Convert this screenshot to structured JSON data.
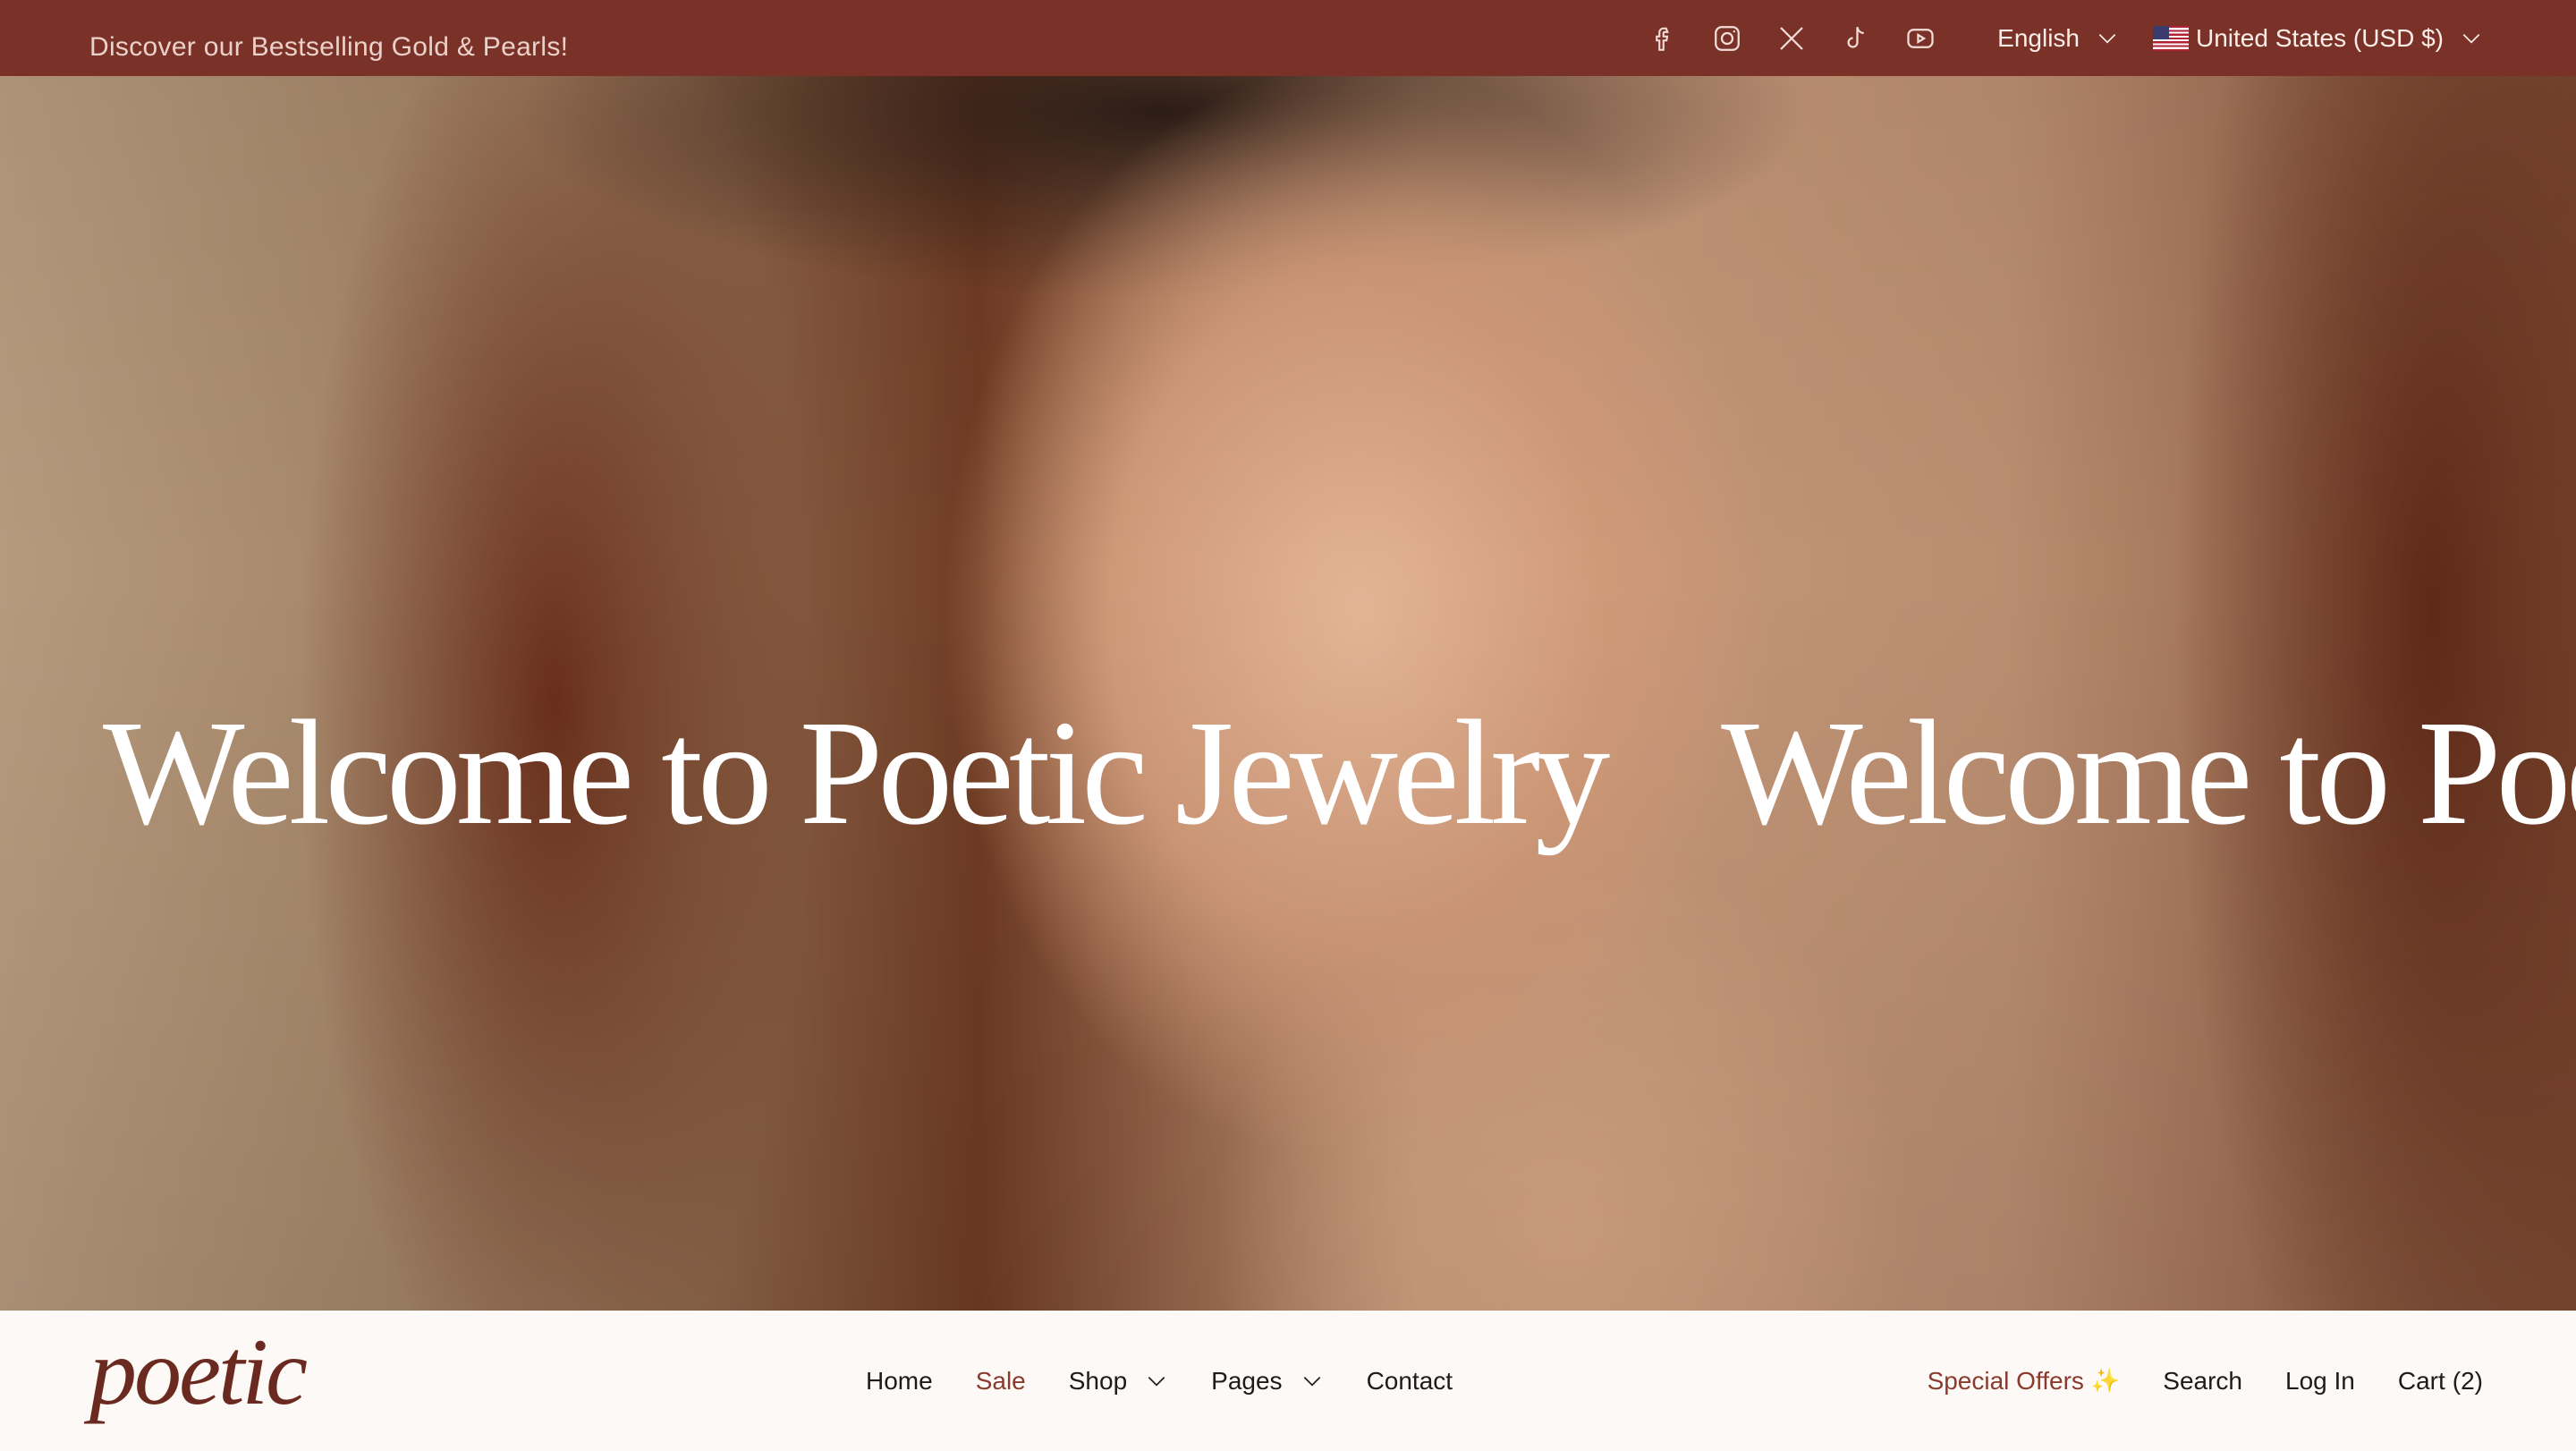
{
  "announcement": "Discover our Bestselling Gold & Pearls!",
  "social": [
    {
      "icon": "facebook-icon"
    },
    {
      "icon": "instagram-icon"
    },
    {
      "icon": "x-twitter-icon"
    },
    {
      "icon": "tiktok-icon"
    },
    {
      "icon": "youtube-icon"
    }
  ],
  "language": "English",
  "country": "United States (USD $)",
  "hero": {
    "title": "Welcome to Poetic Jewelry",
    "title_repeat": "Welcome to Poe"
  },
  "logo": "poetic",
  "nav": {
    "home": "Home",
    "sale": "Sale",
    "shop": "Shop",
    "pages": "Pages",
    "contact": "Contact"
  },
  "actions": {
    "special_offers": "Special Offers",
    "sparkle": "✨",
    "search": "Search",
    "login": "Log In",
    "cart": "Cart",
    "cart_count": "(2)"
  },
  "colors": {
    "topbar": "#7a3128",
    "brand": "#6b2a20",
    "accent": "#8a3a2e",
    "header_bg": "#fdf9f6"
  }
}
